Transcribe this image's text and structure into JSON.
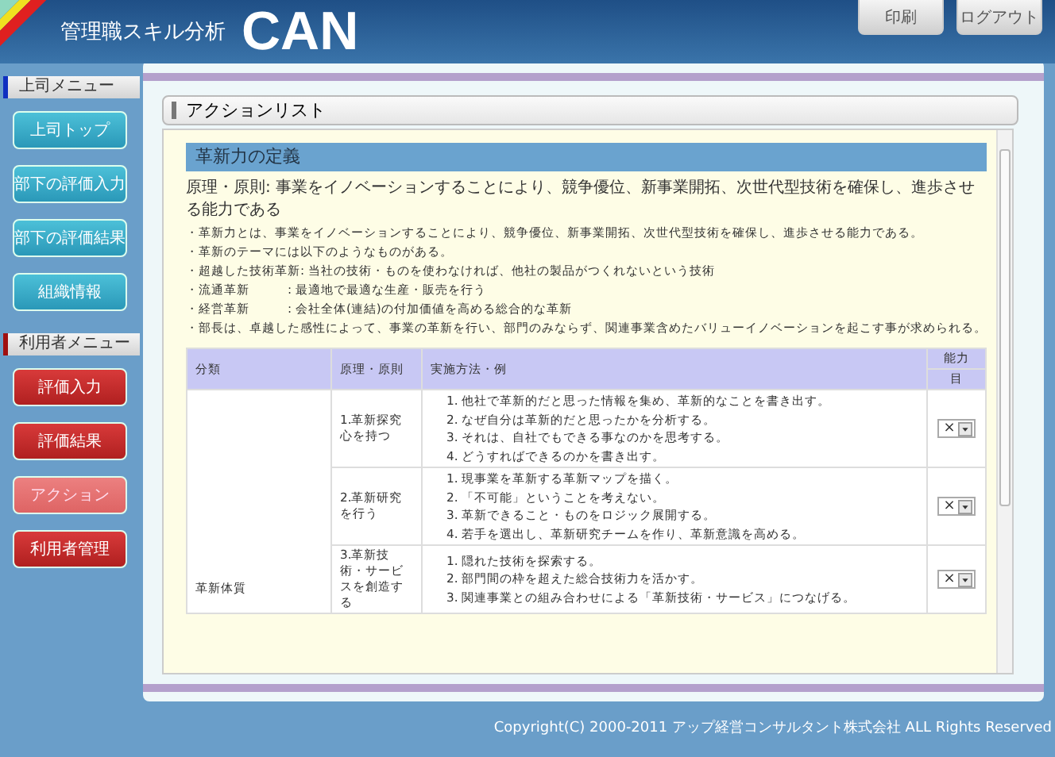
{
  "header": {
    "app_title": "管理職スキル分析",
    "logo": "CAN",
    "buttons": [
      "印刷",
      "ログアウト"
    ]
  },
  "sidebar": {
    "sections": [
      {
        "title": "上司メニュー",
        "kind": "boss",
        "items": [
          {
            "label": "上司トップ",
            "selected": false
          },
          {
            "label": "部下の評価入力",
            "selected": false
          },
          {
            "label": "部下の評価結果",
            "selected": false
          },
          {
            "label": "組織情報",
            "selected": false
          }
        ]
      },
      {
        "title": "利用者メニュー",
        "kind": "user",
        "items": [
          {
            "label": "評価入力",
            "selected": false
          },
          {
            "label": "評価結果",
            "selected": false
          },
          {
            "label": "アクション",
            "selected": true
          },
          {
            "label": "利用者管理",
            "selected": false
          }
        ]
      }
    ]
  },
  "panel": {
    "title": "アクションリスト",
    "definition": {
      "heading": "革新力の定義",
      "principle": "原理・原則: 事業をイノベーションすることにより、競争優位、新事業開拓、次世代型技術を確保し、進歩させる能力である",
      "bullets": [
        "・革新力とは、事業をイノベーションすることにより、競争優位、新事業開拓、次世代型技術を確保し、進歩させる能力である。",
        "・革新のテーマには以下のようなものがある。",
        "・超越した技術革新: 当社の技術・ものを使わなければ、他社の製品がつくれないという技術",
        "・流通革新　　　: 最適地で最適な生産・販売を行う",
        "・経営革新　　　: 会社全体(連結)の付加価値を高める総合的な革新",
        "・部長は、卓越した感性によって、事業の革新を行い、部門のみならず、関連事業含めたバリューイノベーションを起こす事が求められる。"
      ]
    },
    "table": {
      "columns": [
        "分類",
        "原理・原則",
        "実施方法・例",
        "能力"
      ],
      "subheader": "目",
      "category": "革新体質",
      "rows": [
        {
          "principle": "1.革新探究心を持つ",
          "methods": [
            "1. 他社で革新的だと思った情報を集め、革新的なことを書き出す。",
            "2. なぜ自分は革新的だと思ったかを分析する。",
            "3. それは、自社でもできる事なのかを思考する。",
            "4. どうすればできるのかを書き出す。"
          ],
          "value": "×"
        },
        {
          "principle": "2.革新研究を行う",
          "methods": [
            "1. 現事業を革新する革新マップを描く。",
            "2. 「不可能」ということを考えない。",
            "3. 革新できること・ものをロジック展開する。",
            "4. 若手を選出し、革新研究チームを作り、革新意識を高める。"
          ],
          "value": "×"
        },
        {
          "principle": "3.革新技術・サービスを創造する",
          "methods": [
            "1. 隠れた技術を探索する。",
            "2. 部門間の枠を超えた総合技術力を活かす。",
            "3. 関連事業との組み合わせによる「革新技術・サービス」につなげる。"
          ],
          "value": "×"
        }
      ]
    }
  },
  "footer": "Copyright(C) 2000-2011 アップ経営コンサルタント株式会社 ALL Rights Reserved"
}
